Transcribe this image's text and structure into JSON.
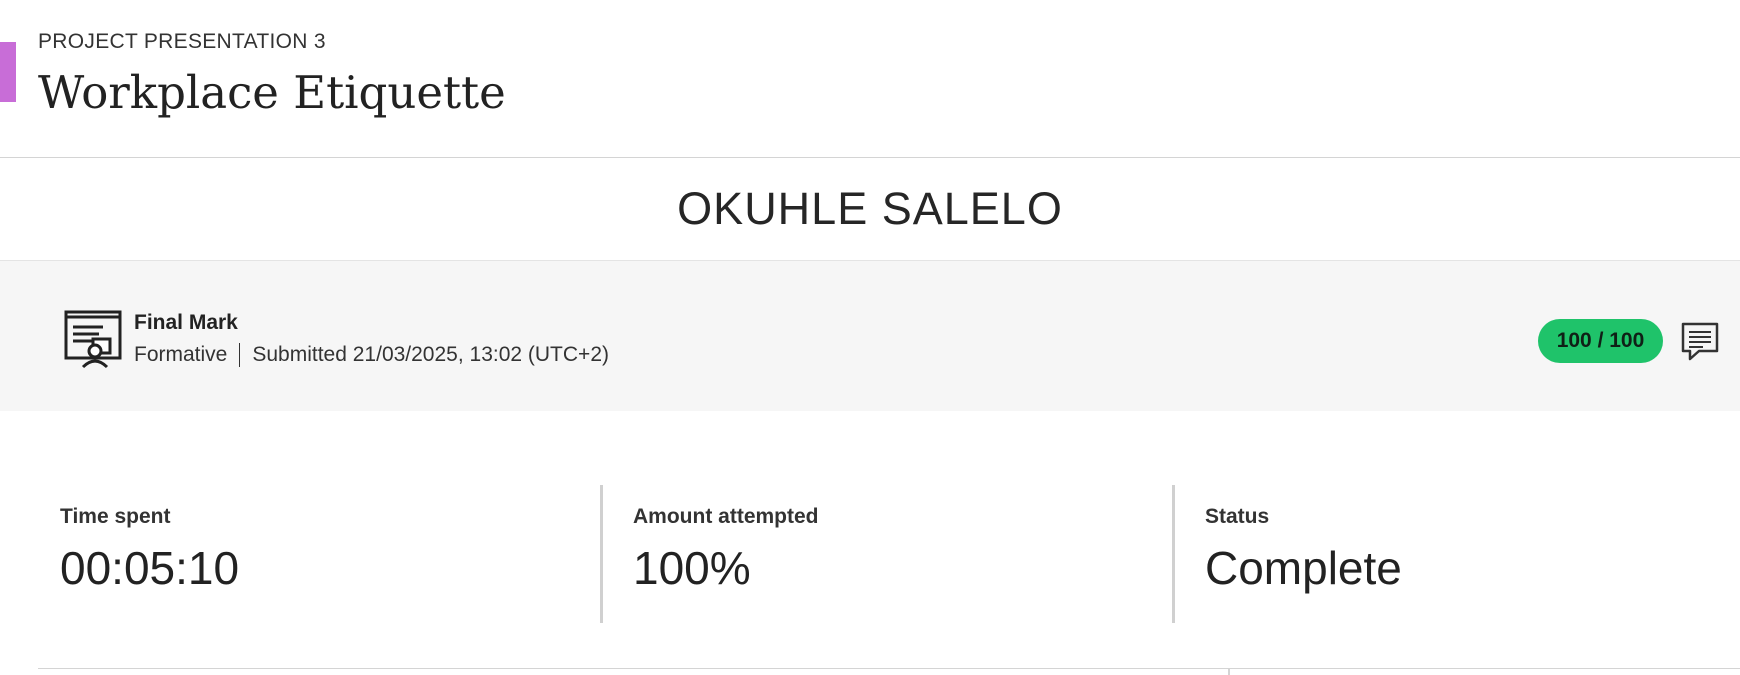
{
  "header": {
    "eyebrow": "PROJECT PRESENTATION 3",
    "title": "Workplace Etiquette",
    "accent_color": "#c86dd7"
  },
  "student": {
    "name": "OKUHLE SALELO"
  },
  "grade": {
    "icon": "certificate-document-icon",
    "title": "Final Mark",
    "type": "Formative",
    "submitted": "Submitted 21/03/2025, 13:02 (UTC+2)",
    "score": "100 / 100",
    "score_color": "#1fc36a",
    "comment_icon": "comment-icon"
  },
  "stats": [
    {
      "label": "Time spent",
      "value": "00:05:10"
    },
    {
      "label": "Amount attempted",
      "value": "100%"
    },
    {
      "label": "Status",
      "value": "Complete"
    }
  ]
}
